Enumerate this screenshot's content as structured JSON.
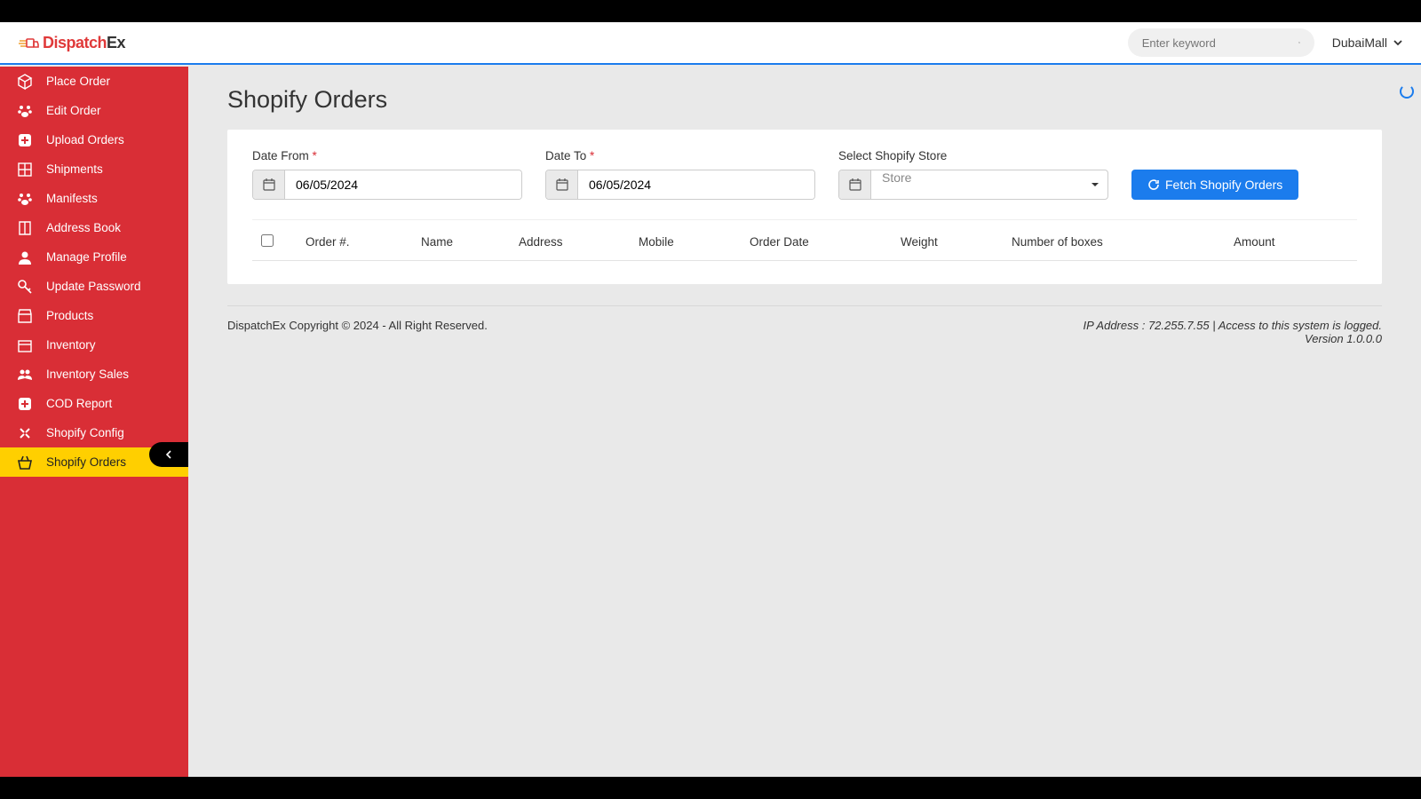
{
  "brand": {
    "part1": "Dispatch",
    "part2": "Ex"
  },
  "search": {
    "placeholder": "Enter keyword"
  },
  "user": {
    "name": "DubaiMall"
  },
  "sidebar": {
    "items": [
      {
        "label": "Place Order",
        "icon": "cube"
      },
      {
        "label": "Edit Order",
        "icon": "paw"
      },
      {
        "label": "Upload Orders",
        "icon": "plus"
      },
      {
        "label": "Shipments",
        "icon": "grid"
      },
      {
        "label": "Manifests",
        "icon": "paw"
      },
      {
        "label": "Address Book",
        "icon": "book"
      },
      {
        "label": "Manage Profile",
        "icon": "user"
      },
      {
        "label": "Update Password",
        "icon": "key"
      },
      {
        "label": "Products",
        "icon": "store"
      },
      {
        "label": "Inventory",
        "icon": "box"
      },
      {
        "label": "Inventory Sales",
        "icon": "users"
      },
      {
        "label": "COD Report",
        "icon": "plus"
      },
      {
        "label": "Shopify Config",
        "icon": "tools"
      },
      {
        "label": "Shopify Orders",
        "icon": "basket",
        "active": true
      }
    ]
  },
  "page": {
    "title": "Shopify Orders",
    "filters": {
      "date_from": {
        "label": "Date From",
        "value": "06/05/2024"
      },
      "date_to": {
        "label": "Date To",
        "value": "06/05/2024"
      },
      "store": {
        "label": "Select Shopify Store",
        "placeholder": "Store"
      },
      "fetch_btn": "Fetch Shopify Orders"
    },
    "columns": [
      "Order #.",
      "Name",
      "Address",
      "Mobile",
      "Order Date",
      "Weight",
      "Number of boxes",
      "Amount"
    ]
  },
  "footer": {
    "left": "DispatchEx Copyright © 2024 - All Right Reserved.",
    "right1": "IP Address : 72.255.7.55 | Access to this system is logged.",
    "right2": "Version 1.0.0.0"
  }
}
